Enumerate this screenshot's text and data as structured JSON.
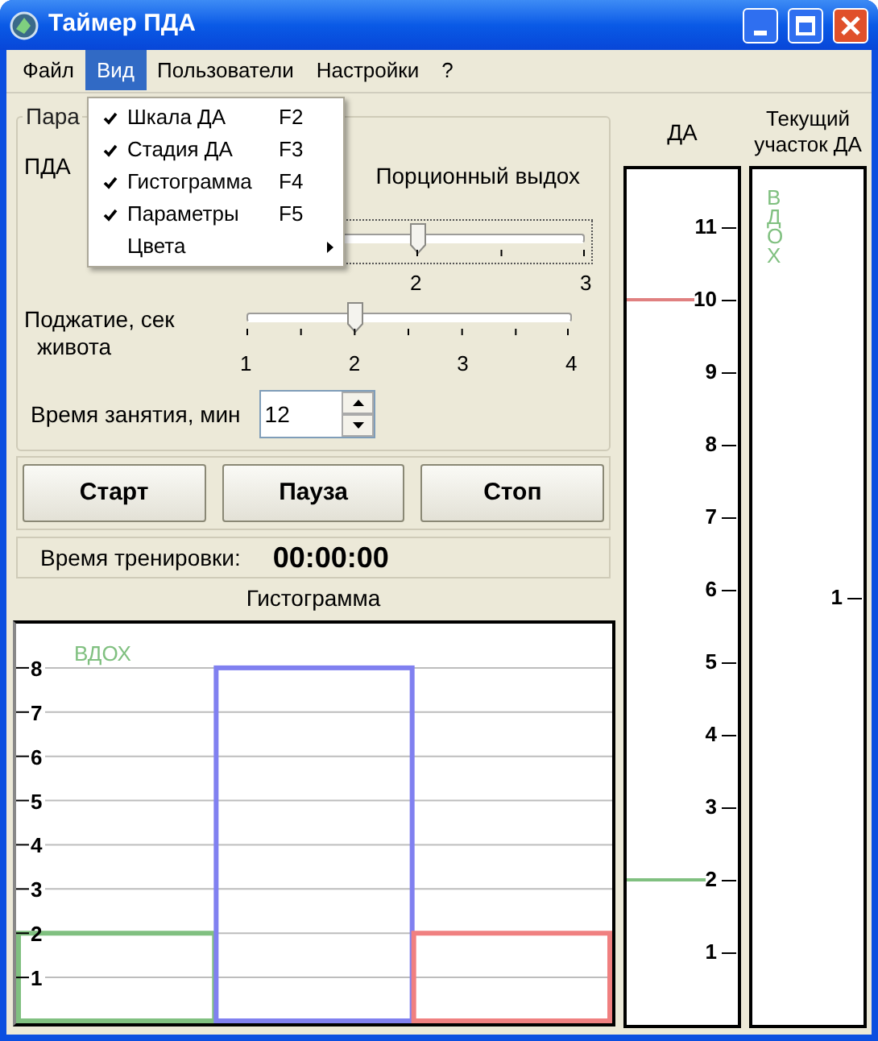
{
  "window": {
    "title": "Таймер ПДА"
  },
  "menu_bar": [
    {
      "label": "Файл",
      "selected": false
    },
    {
      "label": "Вид",
      "selected": true
    },
    {
      "label": "Пользователи",
      "selected": false
    },
    {
      "label": "Настройки",
      "selected": false
    },
    {
      "label": "?",
      "selected": false
    }
  ],
  "open_menu": {
    "items": [
      {
        "kind": "item",
        "label": "Шкала ДА",
        "shortcut": "F2",
        "checked": true
      },
      {
        "kind": "item",
        "label": "Стадия ДА",
        "shortcut": "F3",
        "checked": true
      },
      {
        "kind": "item",
        "label": "Гистограмма",
        "shortcut": "F4",
        "checked": true
      },
      {
        "kind": "item",
        "label": "Параметры",
        "shortcut": "F5",
        "checked": true
      },
      {
        "kind": "submenu",
        "label": "Цвета",
        "checked": false
      }
    ]
  },
  "parameters": {
    "legend": "Пара",
    "mode_label": "ПДА",
    "mode_value": "Порционный выдох",
    "sliders": [
      {
        "labels": [
          "2",
          "3"
        ],
        "level": 0.5
      },
      {
        "label_lines": [
          "Поджатие, сек",
          "живота"
        ],
        "labels": [
          "1",
          "2",
          "3",
          "4"
        ],
        "level": 0.3333
      }
    ],
    "duration": {
      "label": "Время занятия, мин",
      "value": "12"
    }
  },
  "buttons": [
    "Старт",
    "Пауза",
    "Стоп"
  ],
  "training_time": {
    "label": "Время тренировки:",
    "value": "00:00:00"
  },
  "histogram": {
    "title": "Гистограмма",
    "phase_label": "ВДОХ",
    "bars": [
      {
        "color": "#80c080"
      },
      {
        "color": "#8080f0"
      },
      {
        "color": "#f08080"
      }
    ],
    "chart_data": {
      "type": "bar",
      "values": [
        2,
        8,
        2
      ],
      "ylim": [
        0,
        9
      ],
      "yticks": [
        1,
        2,
        3,
        4,
        5,
        6,
        7,
        8
      ],
      "grid": true
    }
  },
  "da_scale": {
    "title": "ДА",
    "ticks": [
      {
        "label": "11"
      },
      {
        "label": "10",
        "color": "#e08080"
      },
      {
        "label": "9"
      },
      {
        "label": "8"
      },
      {
        "label": "7"
      },
      {
        "label": "6"
      },
      {
        "label": "5"
      },
      {
        "label": "4"
      },
      {
        "label": "3"
      },
      {
        "label": "2",
        "color": "#80c080"
      },
      {
        "label": "1"
      }
    ]
  },
  "current_segment": {
    "title_lines": [
      "Текущий",
      "участок ДА"
    ],
    "phase_label": "ВДОХ",
    "tick": "1"
  }
}
